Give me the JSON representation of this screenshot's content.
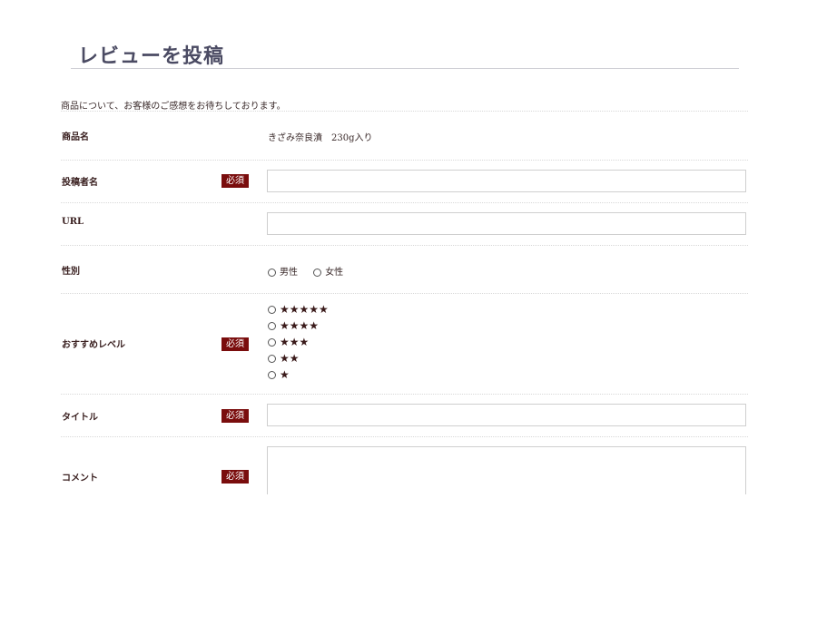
{
  "page": {
    "title": "レビューを投稿"
  },
  "intro": "商品について、お客様のご感想をお待ちしております。",
  "required_label": "必須",
  "form": {
    "product": {
      "label": "商品名",
      "value": "きざみ奈良漬　230g入り"
    },
    "author": {
      "label": "投稿者名",
      "value": ""
    },
    "url": {
      "label": "URL",
      "value": ""
    },
    "gender": {
      "label": "性別",
      "options": [
        "男性",
        "女性"
      ]
    },
    "rating": {
      "label": "おすすめレベル",
      "options": [
        "★★★★★",
        "★★★★",
        "★★★",
        "★★",
        "★"
      ]
    },
    "title": {
      "label": "タイトル",
      "value": ""
    },
    "comment": {
      "label": "コメント",
      "value": ""
    }
  }
}
